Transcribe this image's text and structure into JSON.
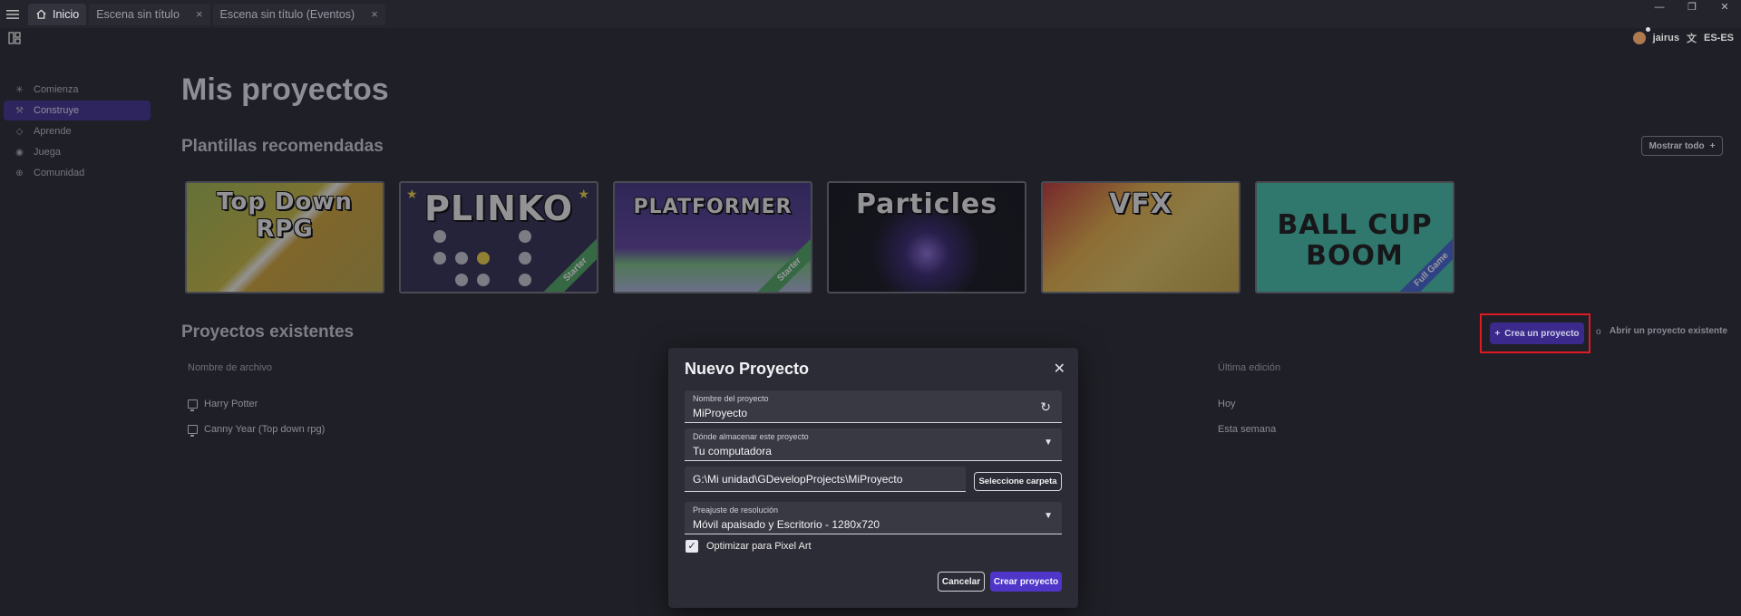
{
  "titlebar": {
    "tabs": [
      {
        "label": "Inicio",
        "active": true
      },
      {
        "label": "Escena sin título",
        "close": "×"
      },
      {
        "label": "Escena sin título (Eventos)",
        "close": "×"
      }
    ],
    "window_controls": [
      "—",
      "❐",
      "✕"
    ]
  },
  "topbar": {
    "username": "jairus",
    "language": "ES-ES"
  },
  "sidebar": {
    "items": [
      {
        "label": "Comienza",
        "icon": "sparkle-icon"
      },
      {
        "label": "Construye",
        "icon": "hammer-icon",
        "active": true
      },
      {
        "label": "Aprende",
        "icon": "graduation-cap-icon"
      },
      {
        "label": "Juega",
        "icon": "gamepad-icon"
      },
      {
        "label": "Comunidad",
        "icon": "globe-icon"
      }
    ]
  },
  "main": {
    "title": "Mis proyectos",
    "templates_title": "Plantillas recomendadas",
    "show_all": "Mostrar todo",
    "templates": [
      {
        "title": "Top Down RPG"
      },
      {
        "title": "PLINKO",
        "ribbon": "Starter"
      },
      {
        "title": "PLATFORMER",
        "ribbon": "Starter"
      },
      {
        "title": "Particles"
      },
      {
        "title": "VFX"
      },
      {
        "title_line1": "BALL CUP",
        "title_line2": "BOOM",
        "ribbon": "Full Game"
      }
    ],
    "existing_title": "Proyectos existentes",
    "create_project": "Crea un proyecto",
    "or": "o",
    "open_existing": "Abrir un proyecto existente",
    "columns": {
      "file_name": "Nombre de archivo",
      "last_edit": "Última edición"
    },
    "projects": [
      {
        "name": "Harry Potter",
        "date": "Hoy"
      },
      {
        "name": "Canny Year (Top down rpg)",
        "date": "Esta semana"
      }
    ]
  },
  "dialog": {
    "title": "Nuevo Proyecto",
    "close": "✕",
    "project_name_label": "Nombre del proyecto",
    "project_name_value": "MiProyecto",
    "storage_label": "Dónde almacenar este proyecto",
    "storage_value": "Tu computadora",
    "path_value": "G:\\Mi unidad\\GDevelopProjects\\MiProyecto",
    "select_folder": "Seleccione carpeta",
    "resolution_label": "Preajuste de resolución",
    "resolution_value": "Móvil apaisado y Escritorio - 1280x720",
    "pixel_art_label": "Optimizar para Pixel Art",
    "pixel_art_checked": true,
    "cancel": "Cancelar",
    "create": "Crear proyecto"
  },
  "colors": {
    "accent": "#4f36c8",
    "sidebar_active": "#3b2a8c",
    "highlight_box": "#e01a22",
    "background": "#1f1f27"
  }
}
